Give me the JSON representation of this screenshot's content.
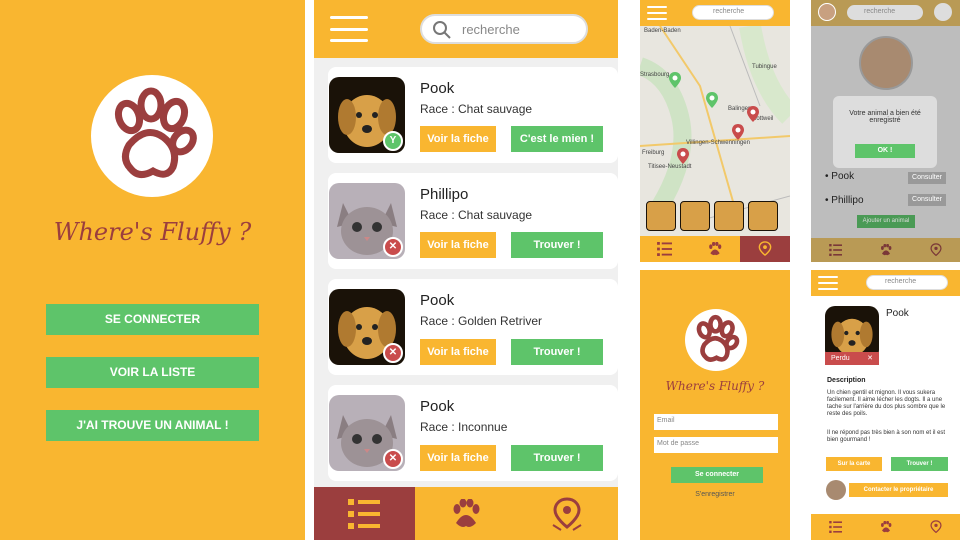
{
  "colors": {
    "brand_orange": "#f9b630",
    "brand_red": "#9b3e3e",
    "action_green": "#5ec46a"
  },
  "login": {
    "title": "Where's Fluffy ?",
    "buttons": [
      "SE CONNECTER",
      "VOIR LA LISTE",
      "J'AI TROUVE UN ANIMAL !"
    ]
  },
  "list": {
    "search_placeholder": "recherche",
    "items": [
      {
        "name": "Pook",
        "race": "Race : Chat  sauvage",
        "btn1": "Voir la fiche",
        "btn2": "C'est le mien !",
        "badge": "Y",
        "kind": "dog"
      },
      {
        "name": "Phillipo",
        "race": "Race : Chat  sauvage",
        "btn1": "Voir la fiche",
        "btn2": "Trouver !",
        "badge": "✕",
        "kind": "cat"
      },
      {
        "name": "Pook",
        "race": "Race : Golden Retriver",
        "btn1": "Voir la fiche",
        "btn2": "Trouver !",
        "badge": "✕",
        "kind": "dog"
      },
      {
        "name": "Pook",
        "race": "Race : Inconnue",
        "btn1": "Voir la fiche",
        "btn2": "Trouver !",
        "badge": "✕",
        "kind": "cat"
      }
    ]
  },
  "map": {
    "search_placeholder": "recherche",
    "labels": [
      "Baden-Baden",
      "Tubingue",
      "Balingen",
      "Rottweil",
      "Villingen-Schwenningen",
      "Freiburg",
      "Titisee-Neustadt",
      "Strasbourg"
    ]
  },
  "login_small": {
    "title": "Where's Fluffy ?",
    "email_placeholder": "Email",
    "password_placeholder": "Mot de passe",
    "submit": "Se connecter",
    "register": "S'enregistrer"
  },
  "profile": {
    "search_placeholder": "recherche",
    "modal_text": "Votre animal a bien été enregistré",
    "modal_ok": "OK !",
    "pets": [
      "Pook",
      "Phillipo"
    ],
    "consult": "Consulter",
    "add_pet": "Ajouter un animal"
  },
  "detail": {
    "search_placeholder": "recherche",
    "name": "Pook",
    "status": "Perdu",
    "description_heading": "Description",
    "description": "Un chien gentil et mignon. Il vous sukera facilement. Il aime lécher les dogts. Il a une tache sur l'arrière du dos plus sombre que le reste des poils.",
    "description2": "Il ne répond pas très bien à son nom et il est bien gourmand !",
    "btn_map": "Sur la carte",
    "btn_find": "Trouver !",
    "btn_contact": "Contacter le propriétaire"
  }
}
